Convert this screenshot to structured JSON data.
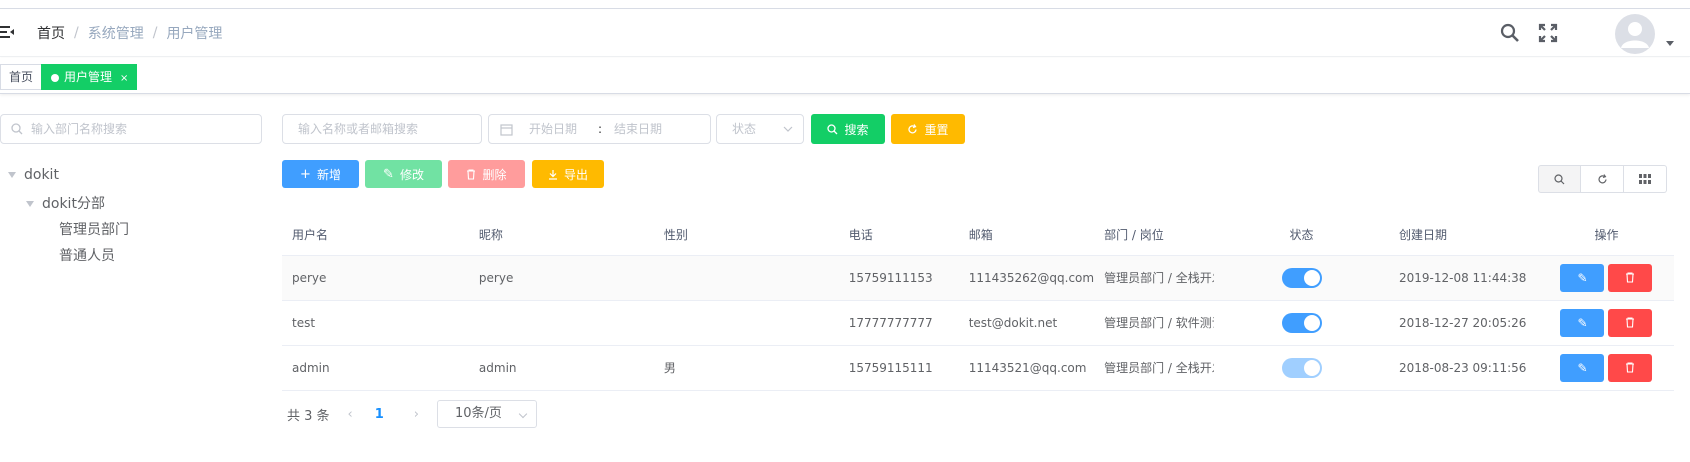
{
  "colors": {
    "primary": "#409eff",
    "success": "#13ce66",
    "warning": "#ffba00",
    "danger": "#ff4949",
    "tag_active": "#13ce66"
  },
  "navbar": {
    "breadcrumb": [
      "首页",
      "系统管理",
      "用户管理"
    ],
    "separator": "/",
    "icons": [
      "hamburger-icon",
      "search-icon",
      "fullscreen-icon",
      "avatar-icon",
      "caret-down-icon"
    ]
  },
  "tags": [
    {
      "label": "首页",
      "active": false
    },
    {
      "label": "用户管理",
      "active": true,
      "close": "×"
    }
  ],
  "dept_search": {
    "placeholder": "输入部门名称搜索"
  },
  "tree": [
    {
      "label": "dokit",
      "level": 0,
      "expanded": true
    },
    {
      "label": "dokit分部",
      "level": 1,
      "expanded": true
    },
    {
      "label": "管理员部门",
      "level": 2
    },
    {
      "label": "普通人员",
      "level": 2
    }
  ],
  "filters": {
    "search_placeholder": "输入名称或者邮箱搜索",
    "date_start_placeholder": "开始日期",
    "date_separator": ":",
    "date_end_placeholder": "结束日期",
    "status_placeholder": "状态",
    "search_label": "搜索",
    "reset_label": "重置"
  },
  "actions": {
    "add": "新增",
    "edit": "修改",
    "delete": "删除",
    "export": "导出"
  },
  "table": {
    "headers": [
      "用户名",
      "昵称",
      "性别",
      "电话",
      "邮箱",
      "部门 / 岗位",
      "状态",
      "创建日期",
      "操作"
    ],
    "rows": [
      {
        "username": "perye",
        "nickname": "perye",
        "gender": "",
        "phone": "15759111153",
        "email": "111435262@qq.com",
        "dept": "管理员部门 / 全栈开发",
        "enabled": true,
        "switch_disabled": false,
        "created": "2019-12-08 11:44:38"
      },
      {
        "username": "test",
        "nickname": "",
        "gender": "",
        "phone": "17777777777",
        "email": "test@dokit.net",
        "dept": "管理员部门 / 软件测试",
        "enabled": true,
        "switch_disabled": false,
        "created": "2018-12-27 20:05:26"
      },
      {
        "username": "admin",
        "nickname": "admin",
        "gender": "男",
        "phone": "15759115111",
        "email": "11143521@qq.com",
        "dept": "管理员部门 / 全栈开发",
        "enabled": true,
        "switch_disabled": true,
        "created": "2018-08-23 09:11:56"
      }
    ]
  },
  "pagination": {
    "total_text": "共 3 条",
    "current_page": "1",
    "page_size": "10条/页",
    "prev": "‹",
    "next": "›"
  }
}
